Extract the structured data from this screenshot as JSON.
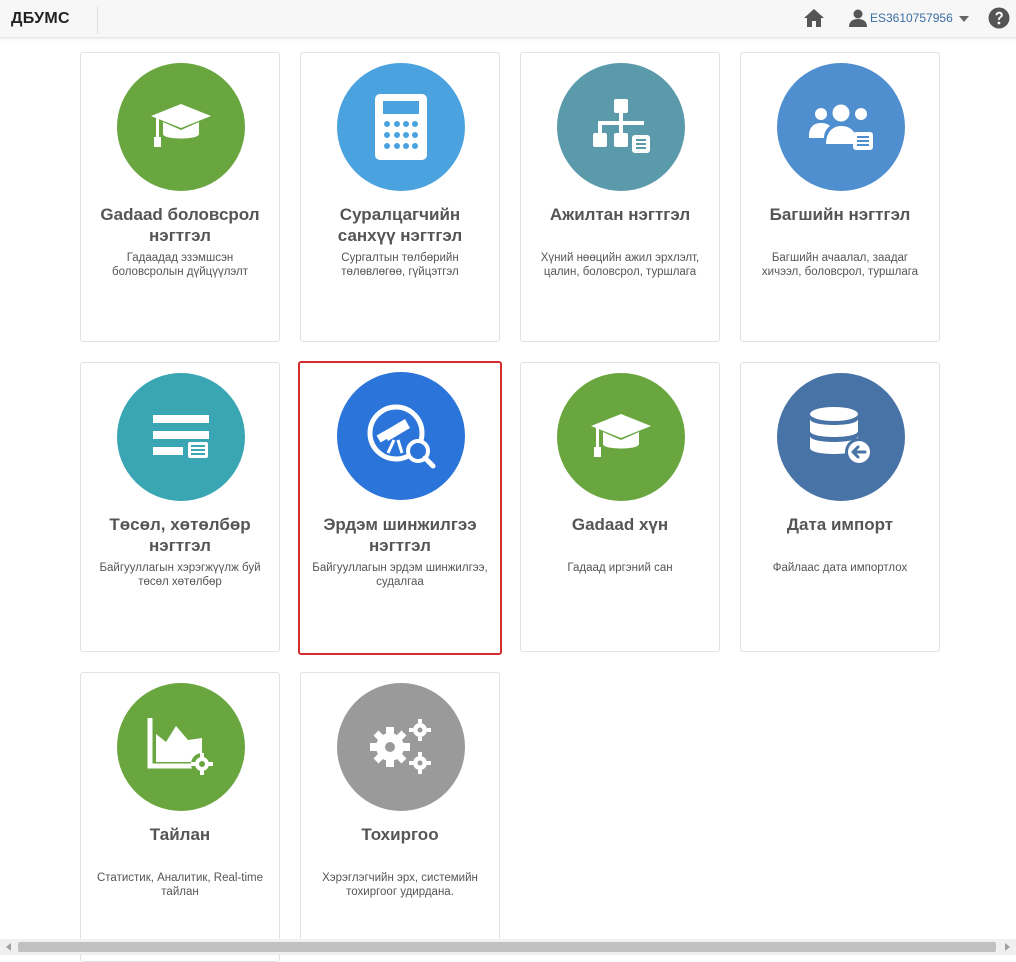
{
  "header": {
    "brand": "ДБУМС",
    "username": "ES3610757956"
  },
  "colors": {
    "green": "#6aa63f",
    "light_blue": "#4aa3df",
    "teal_gray": "#5b9aab",
    "blue": "#4f8fcf",
    "teal": "#3aa5b3",
    "royal_blue": "#2b74d9",
    "steel_blue": "#4873a6",
    "gray": "#9a9a9a",
    "selected_border": "#d32f2f"
  },
  "cards": [
    {
      "title": "Gadaad боловсрол нэгтгэл",
      "desc": "Гадаадад эзэмшсэн боловсролын дүйцүүлэлт",
      "icon": "graduation-cap-icon"
    },
    {
      "title": "Суралцагчийн санхүү нэгтгэл",
      "desc": "Сургалтын төлбөрийн төлөвлөгөө, гүйцэтгэл",
      "icon": "calculator-icon"
    },
    {
      "title": "Ажилтан нэгтгэл",
      "desc": "Хүний нөөцийн ажил эрхлэлт, цалин, боловсрол, туршлага",
      "icon": "org-chart-icon"
    },
    {
      "title": "Багшийн нэгтгэл",
      "desc": "Багшийн ачаалал, заадаг хичээл, боловсрол, туршлага",
      "icon": "users-group-icon"
    },
    {
      "title": "Төсөл, хөтөлбөр нэгтгэл",
      "desc": "Байгууллагын хэрэгжүүлж буй төсөл хөтөлбөр",
      "icon": "list-table-icon"
    },
    {
      "title": "Эрдэм шинжилгээ нэгтгэл",
      "desc": "Байгууллагын эрдэм шинжилгээ, судалгаа",
      "icon": "telescope-search-icon"
    },
    {
      "title": "Gadaad хүн",
      "desc": "Гадаад иргэний сан",
      "icon": "graduation-cap-icon"
    },
    {
      "title": "Дата импорт",
      "desc": "Файлаас дата импортлох",
      "icon": "database-import-icon"
    },
    {
      "title": "Тайлан",
      "desc": "Статистик, Аналитик, Real-time тайлан",
      "icon": "chart-gear-icon"
    },
    {
      "title": "Тохиргоо",
      "desc": "Хэрэглэгчийн эрх, системийн тохиргоог удирдана.",
      "icon": "gears-icon"
    }
  ]
}
